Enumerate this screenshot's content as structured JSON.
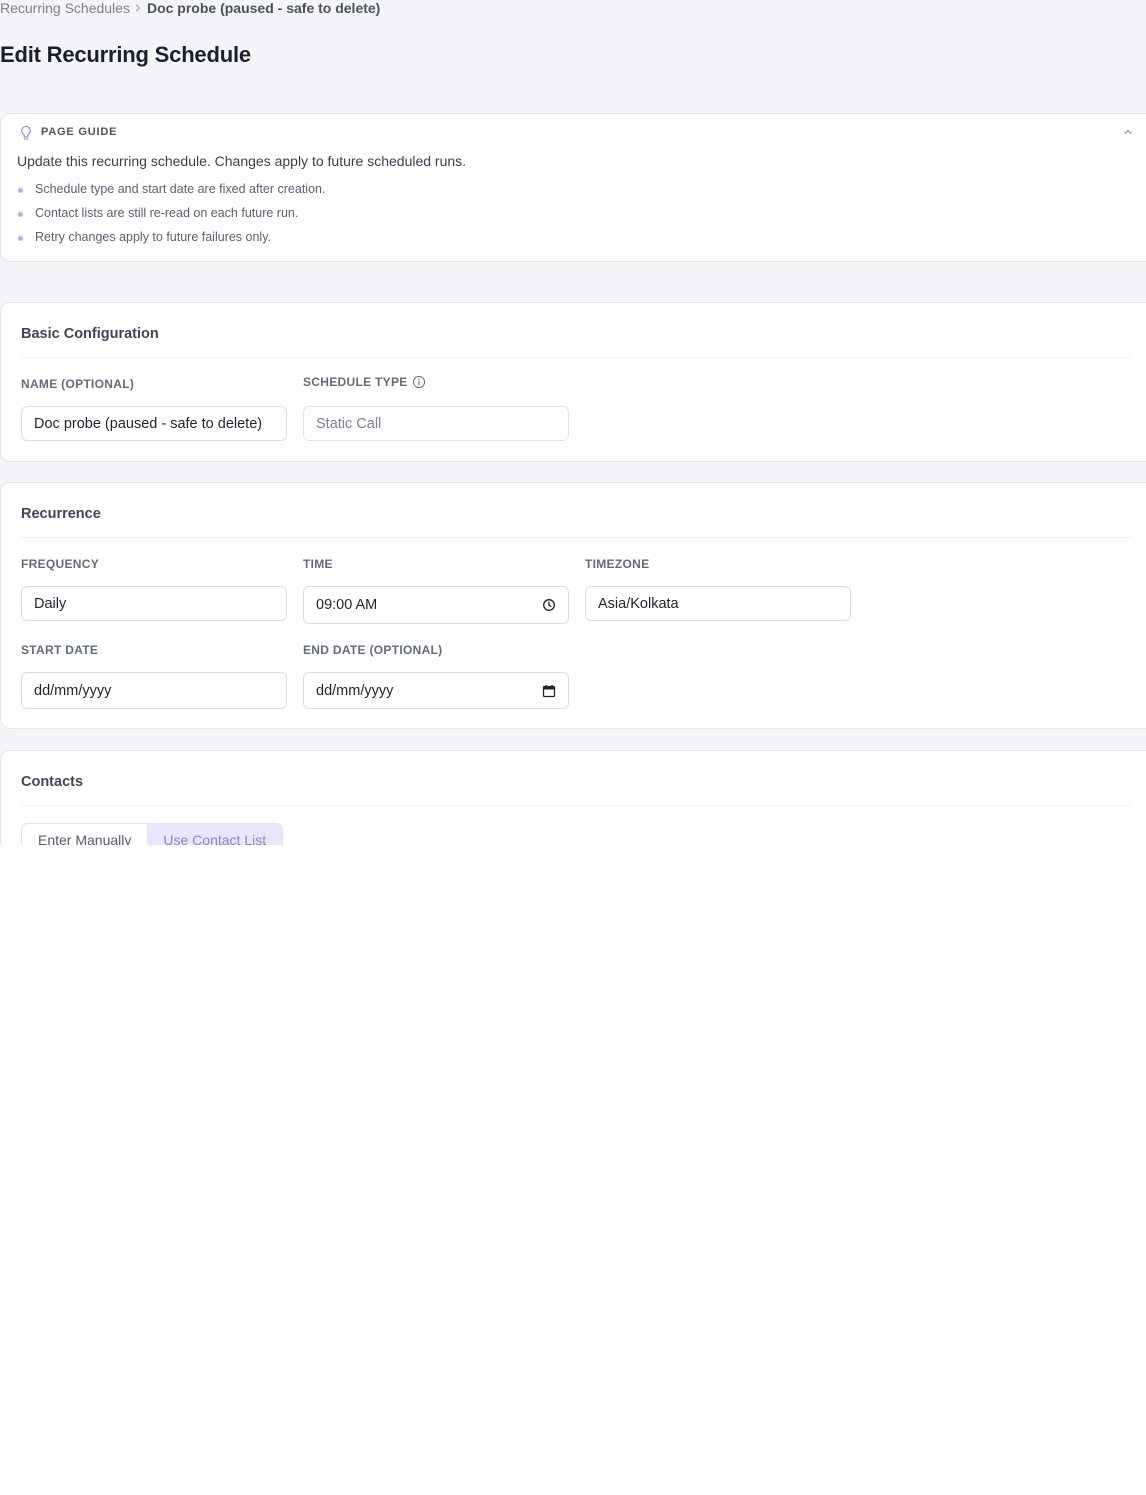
{
  "breadcrumb": {
    "parent": "Recurring Schedules",
    "current": "Doc probe (paused - safe to delete)"
  },
  "page": {
    "title": "Edit Recurring Schedule"
  },
  "guide": {
    "title": "PAGE GUIDE",
    "description": "Update this recurring schedule. Changes apply to future scheduled runs.",
    "items": [
      "Schedule type and start date are fixed after creation.",
      "Contact lists are still re-read on each future run.",
      "Retry changes apply to future failures only."
    ]
  },
  "basic": {
    "title": "Basic Configuration",
    "name_label": "NAME (OPTIONAL)",
    "name_value": "Doc probe (paused - safe to delete)",
    "type_label": "SCHEDULE TYPE",
    "type_value": "Static Call"
  },
  "recurrence": {
    "title": "Recurrence",
    "frequency_label": "FREQUENCY",
    "frequency_value": "Daily",
    "time_label": "TIME",
    "time_value": "09:00 AM",
    "timezone_label": "TIMEZONE",
    "timezone_value": "Asia/Kolkata",
    "start_label": "START DATE",
    "start_value": "dd/mm/yyyy",
    "end_label": "END DATE (OPTIONAL)",
    "end_value": "dd/mm/yyyy"
  },
  "contacts": {
    "title": "Contacts",
    "tab_manual": "Enter Manually",
    "tab_list": "Use Contact List"
  },
  "colors": {
    "accent": "#8b82d9",
    "accent_bg": "#e9e6fb",
    "page_bg": "#f4f5f9"
  },
  "icons": [
    "chevron-right-icon",
    "lightbulb-icon",
    "chevron-up-icon",
    "info-icon",
    "clock-icon",
    "calendar-icon"
  ]
}
